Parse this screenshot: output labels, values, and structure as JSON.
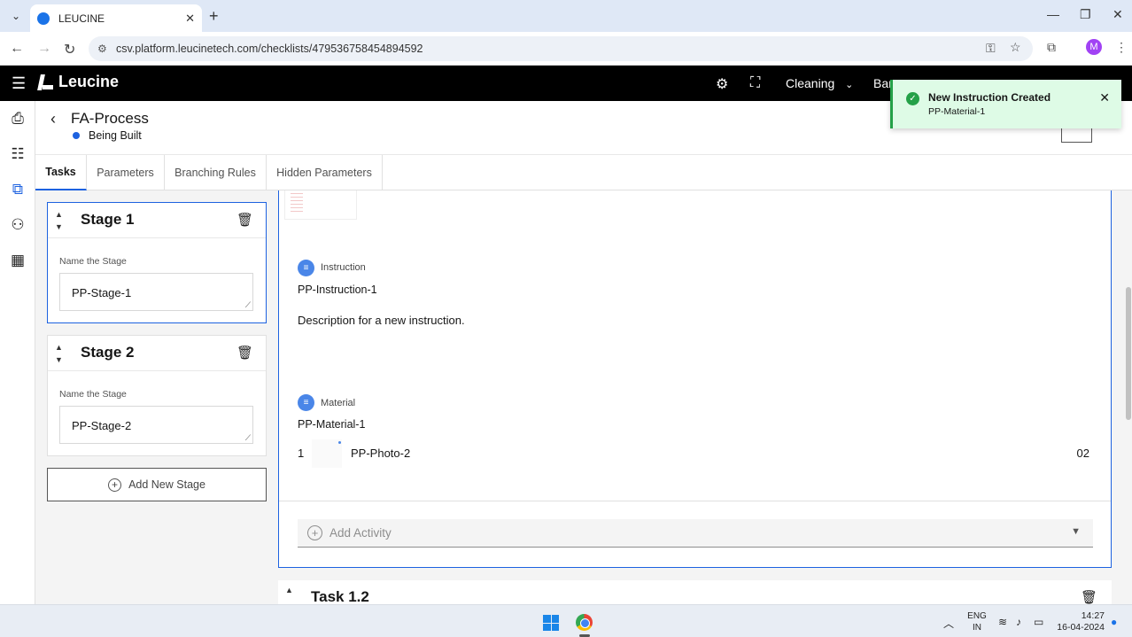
{
  "browser": {
    "tab_title": "LEUCINE",
    "url": "csv.platform.leucinetech.com/checklists/479536758454894592",
    "profile_initial": "M"
  },
  "header": {
    "brand": "Leucine",
    "facility": "Cleaning",
    "truncated_1": "Ban"
  },
  "page": {
    "title": "FA-Process",
    "status": "Being Built"
  },
  "tabs": [
    {
      "label": "Tasks"
    },
    {
      "label": "Parameters"
    },
    {
      "label": "Branching Rules"
    },
    {
      "label": "Hidden Parameters"
    }
  ],
  "stages": [
    {
      "name": "Stage 1",
      "field_label": "Name the Stage",
      "value": "PP-Stage-1"
    },
    {
      "name": "Stage 2",
      "field_label": "Name the Stage",
      "value": "PP-Stage-2"
    }
  ],
  "add_stage_label": "Add New Stage",
  "task": {
    "instruction": {
      "type": "Instruction",
      "name": "PP-Instruction-1",
      "description": "Description for a new instruction."
    },
    "material": {
      "type": "Material",
      "name": "PP-Material-1",
      "index": "1",
      "item": "PP-Photo-2",
      "qty": "02"
    },
    "add_activity": "Add Activity"
  },
  "next_task": "Task 1.2",
  "toast": {
    "title": "New Instruction Created",
    "subtitle": "PP-Material-1"
  },
  "taskbar": {
    "lang1": "ENG",
    "lang2": "IN",
    "time": "14:27",
    "date": "16-04-2024"
  },
  "colors": {
    "accent": "#1d62e0",
    "success": "#24a148",
    "appbar": "#000000"
  }
}
